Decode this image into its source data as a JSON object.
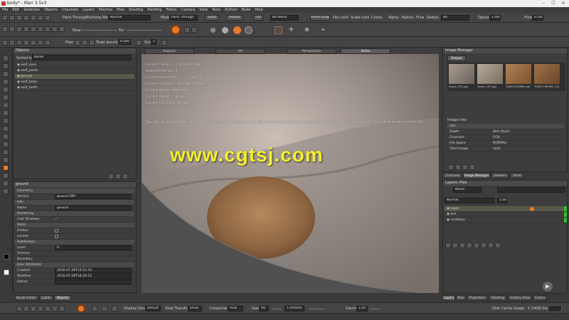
{
  "window": {
    "title": "body* - Mari 3.5v3",
    "min": "–",
    "max": "☐",
    "close": "✕"
  },
  "menu": [
    "File",
    "Edit",
    "Selection",
    "Objects",
    "Channels",
    "Layers",
    "Patches",
    "Ptex",
    "Shading",
    "Painting",
    "Filters",
    "Camera",
    "View",
    "Tools",
    "Python",
    "Nuke",
    "Help"
  ],
  "toolbar1": {
    "paint_through": "Paint Through",
    "painting_mode_label": "Painting Mode",
    "painting_mode": "Normal",
    "mode_label": "Mode",
    "mode_value": "Paint Through",
    "bake": "Bake",
    "swap": "Swap",
    "repeat": "Repeat",
    "tint": "Tint",
    "blend": "No Blend",
    "reset_image": "Reset Image",
    "pan_lock": "Pan Lock",
    "scale_lock": "Scale Lock",
    "colors": "Colors",
    "alpha": "Alpha",
    "radius_lbl": "Radius",
    "flow_lbl": "Flow",
    "radius2": "Radius",
    "radius_val": "80",
    "opacity_lbl": "Opacity",
    "opacity_val": "1.000",
    "flow_lbl2": "Flow",
    "flow_val": "0.500"
  },
  "toolbar2": {
    "near": "Near",
    "far": "Far"
  },
  "toolbar3": {
    "ptex": "Ptex",
    "texel_density": "Texel density",
    "texel_val": "0.500",
    "size": "Size",
    "size_val": "1"
  },
  "objects_panel": {
    "title": "Objects",
    "sorted_by": "Sorted by",
    "sort_value": "Name",
    "items": [
      "wolf_eyes",
      "wolf_pants",
      "ground",
      "wolf_body",
      "wolf_teeth"
    ]
  },
  "viewport": {
    "tabs": [
      "Projects",
      "UV",
      "Perspective",
      "Ortho"
    ],
    "hud": [
      "Current Camera: ..... Projector: 4K ...",
      "Selected Patches: 0",
      "Current Layer Paint: .......... Layer 1 ...",
      "Current Channel: ... ground ... diffuse ...",
      "Current Shader: diffuseAO ...",
      "Current Object: ... ground",
      "Current Tool: Paint Through ..."
    ],
    "hints": "Tool Help:  Radius (R)  Rotate (W)  Opacity (S)  Squash (Q)  Scale Image (Ctrl+Shift)  Move Image (Shift)  Rotate Image (Ctrl)  Swap Image (Z)  Reset Repeat (Ctrl+E)  Selected Mode (Shift+Tab)",
    "watermark": "www.cgtsj.com"
  },
  "properties_panel": {
    "name": "ground",
    "sections": {
      "geometry": "Geometry",
      "version_lbl": "Version",
      "version_val": "ground OBY",
      "info": "Info",
      "name_lbl": "Name",
      "name_val": "ground",
      "rendering": "Rendering",
      "cast_shadows": "Cast Shadows",
      "state": "State",
      "hidden": "Hidden",
      "locked": "Locked",
      "subdivision": "Subdivision",
      "level_lbl": "Level",
      "level_val": "0",
      "scheme": "Scheme",
      "boundary": "Boundary",
      "user_attributes": "User Attributes",
      "created_lbl": "Created",
      "created_val": "2016-07-28T14:51:53",
      "modified_lbl": "Modified",
      "modified_val": "2016-07-28T18:26:12",
      "owner_lbl": "Owner"
    }
  },
  "left_tabs": [
    "Brush Editor",
    "Lights",
    "Objects"
  ],
  "image_manager": {
    "title": "Image Manager",
    "project_tab": "Project",
    "thumbs": [
      "stone_225.jpg",
      "stone_107.jpg",
      "52802429896_afe",
      "52802796395_c7a"
    ],
    "info_title": "Image Info",
    "info_rows": [
      {
        "k": "Info",
        "v": ""
      },
      {
        "k": "Depth",
        "v": "8bit (Byte)"
      },
      {
        "k": "Channels",
        "v": "RGB"
      },
      {
        "k": "File Space",
        "v": "NORMAL"
      },
      {
        "k": "Tiled Image",
        "v": "false"
      }
    ]
  },
  "right_tabs1": [
    "Channels",
    "Image Manager",
    "Shaders",
    "Shelf"
  ],
  "layers_panel": {
    "title": "Layers: Ptex",
    "filter": "Name",
    "blend": "Normal",
    "opacity": "1.000",
    "layers": [
      "Layer",
      "dirt",
      "rockBase"
    ]
  },
  "right_tabs2": [
    "Layers",
    "Ptex",
    "Projection",
    "Painting",
    "History View",
    "Colors"
  ],
  "bottom": {
    "display_device_lbl": "Display Device",
    "display_device": "default",
    "view_transform_lbl": "View Transform",
    "view_transform": "sRGB",
    "component_lbl": "Component",
    "component": "RGB",
    "gain_lbl": "Gain",
    "gain": "f/8",
    "gain_val": "1.000000",
    "gamma_lbl": "Gamma",
    "gamma_val": "1.00",
    "disk_cache": "Disk Cache Usage : 1.14GB Used"
  },
  "colors": {
    "accent": "#e8782a",
    "watermark": "#f4ef2c",
    "panel": "#3d3d3d",
    "selected": "#5a5a4a"
  }
}
